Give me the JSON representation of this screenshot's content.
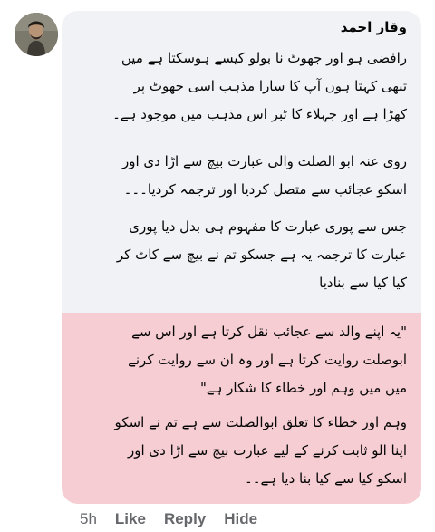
{
  "comment": {
    "author": "وقار احمد",
    "paragraphs": [
      {
        "lines": [
          "رافضی ہو اور جھوٹ نا بولو کیسے ہوسکتا ہے میں",
          "تبھی کہتا ہوں آپ کا سارا مذہب اسی جھوٹ پر",
          "کھڑا ہے اور جہلاء کا ٹبر اس مذہب میں موجود ہے۔"
        ]
      },
      {
        "lines": [
          "روی عنہ ابو الصلت والی عبارت بیچ سے اڑا دی اور",
          "اسکو عجائب سے متصل کردیا اور ترجمہ کردیا۔۔۔"
        ]
      },
      {
        "lines": [
          "جس سے پوری عبارت کا مفہوم ہی بدل دیا پوری",
          "عبارت کا ترجمہ یہ ہے جسکو تم نے بیچ سے کاٹ کر",
          "کیا کیا سے بنادیا"
        ]
      },
      {
        "lines": [
          "\"یہ اپنے والد سے عجائب نقل کرتا ہے اور اس سے",
          "ابوصلت روایت کرتا ہے اور وہ ان سے روایت کرنے",
          "میں میں وہم اور خطاء کا شکار ہے\""
        ]
      },
      {
        "lines": [
          "وہم اور خطاء کا تعلق ابوالصلت سے ہے تم نے اسکو",
          "اپنا الو ثابت کرنے کے لیے عبارت بیچ سے اڑا دی اور",
          "اسکو کیا سے کیا بنا دیا ہے۔۔"
        ]
      }
    ]
  },
  "actions": {
    "time": "5h",
    "like": "Like",
    "reply": "Reply",
    "hide": "Hide"
  },
  "colors": {
    "bubble": "#f0f2f5",
    "highlight": "#f5cdd2",
    "text": "#050505",
    "muted": "#65676b"
  }
}
